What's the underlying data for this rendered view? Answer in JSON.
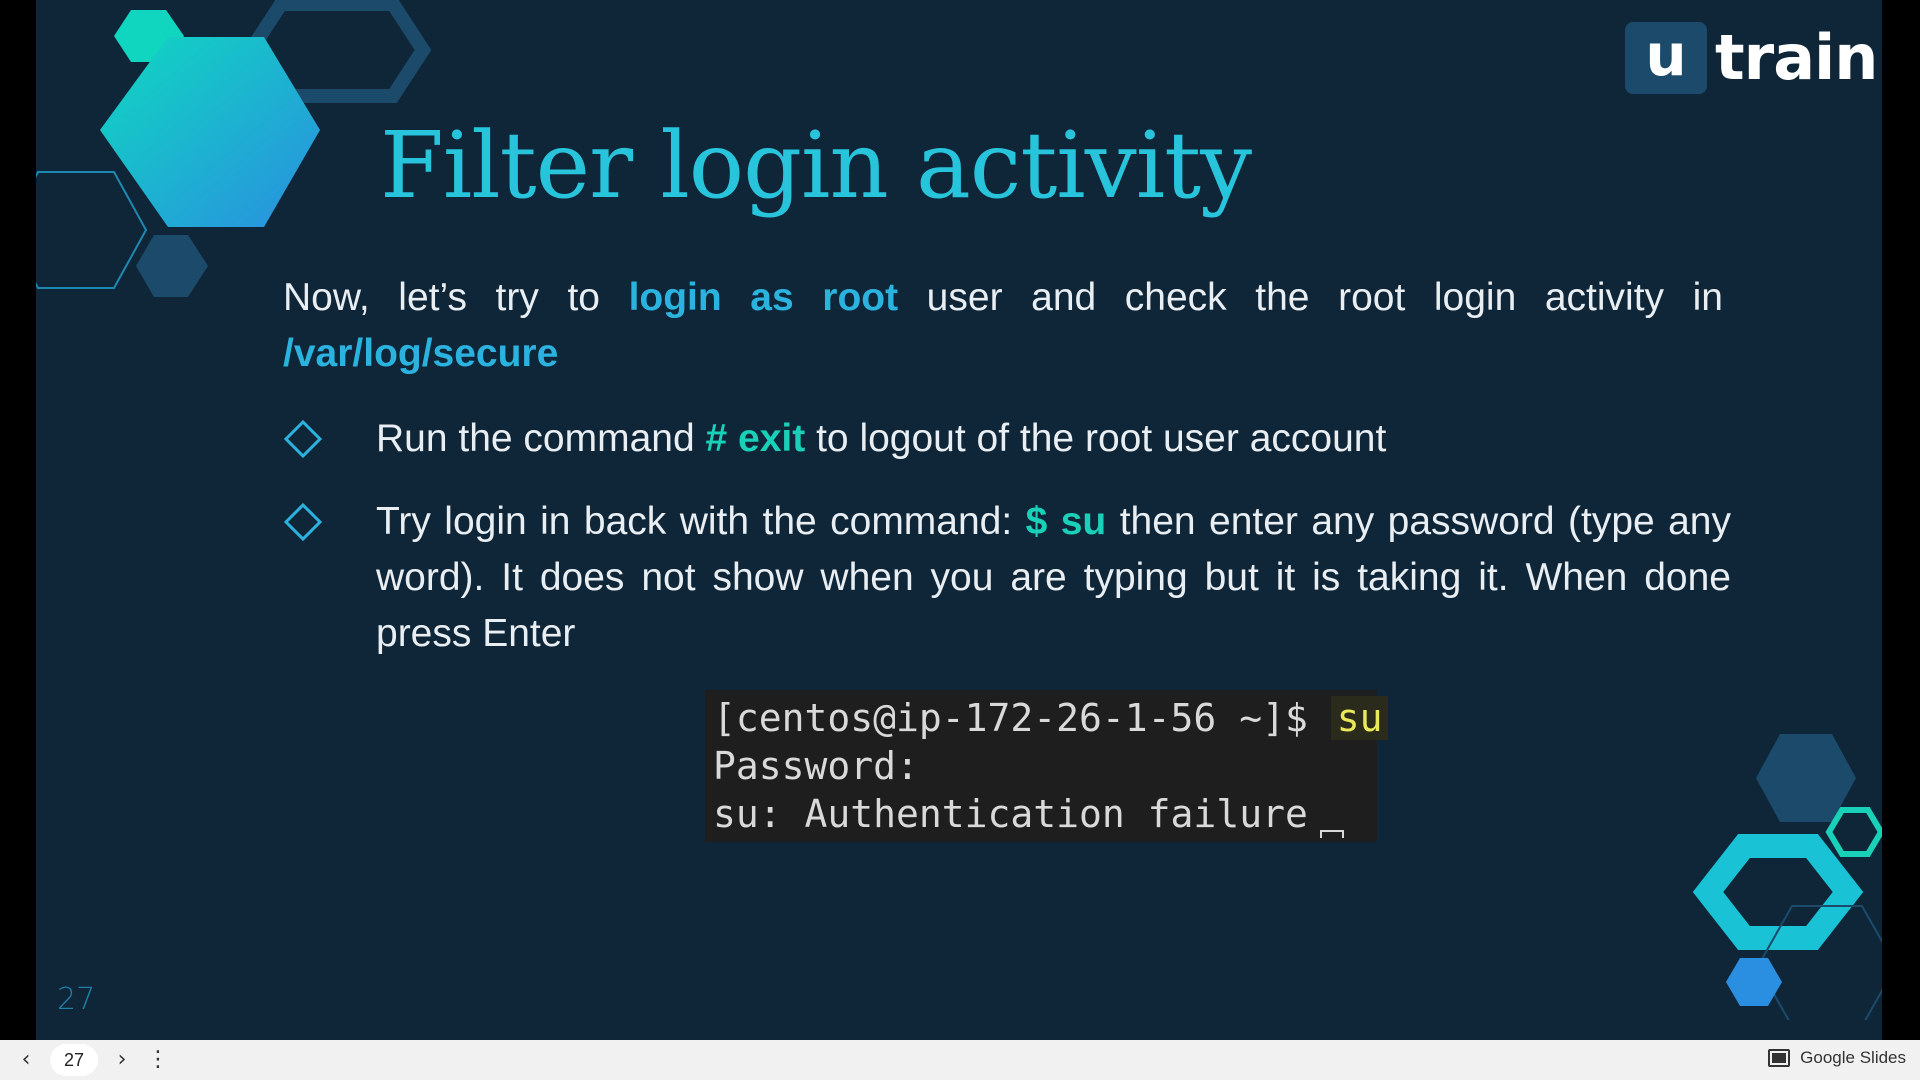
{
  "slide": {
    "title": "Filter login activity",
    "intro": {
      "part1": "Now, let’s try to ",
      "hl1": "login as root",
      "part2": " user and check the root login activity in ",
      "hl2": "/var/log/secure"
    },
    "bullets": [
      {
        "part1": "Run the command ",
        "hl": "# exit",
        "part2": " to logout of the root user account"
      },
      {
        "part1": "Try login in back with the command: ",
        "hl": "$ su",
        "part2": " then enter any password (type any word). It does not show when you are typing but it is taking it. When done press Enter"
      }
    ],
    "terminal": {
      "prompt": "[centos@ip-172-26-1-56 ~]$ ",
      "command": "su",
      "line2": "Password:",
      "line3": "su: Authentication failure"
    },
    "slide_number": "27",
    "logo": {
      "u": "u",
      "train": "train"
    }
  },
  "player": {
    "prev_icon": "chevron-left-icon",
    "page": "27",
    "next_icon": "chevron-right-icon",
    "more_icon": "more-vertical-icon",
    "brand": "Google Slides"
  },
  "colors": {
    "background": "#0f2639",
    "title": "#27c4dc",
    "highlight_blue": "#2bb3df",
    "highlight_green": "#19d1b8"
  }
}
